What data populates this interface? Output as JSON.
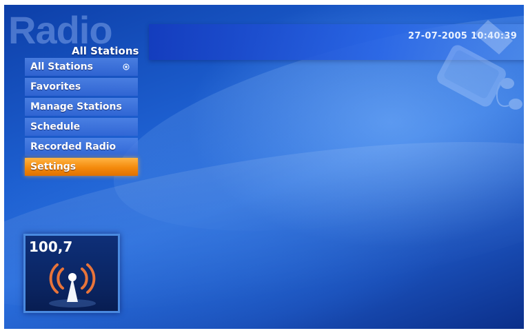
{
  "header": {
    "app_title": "Radio",
    "section_title": "All Stations",
    "datetime": "27-07-2005 10:40:39"
  },
  "menu": {
    "items": [
      {
        "label": "All Stations",
        "selected": false
      },
      {
        "label": "Favorites",
        "selected": false
      },
      {
        "label": "Manage Stations",
        "selected": false
      },
      {
        "label": "Schedule",
        "selected": false
      },
      {
        "label": "Recorded Radio",
        "selected": false
      },
      {
        "label": "Settings",
        "selected": true
      }
    ]
  },
  "now_playing": {
    "frequency": "100,7",
    "icon": "radio-antenna-icon"
  },
  "colors": {
    "accent": "#f48a0c",
    "background": "#1d5fd0",
    "menu_item": "#3f7be0"
  }
}
